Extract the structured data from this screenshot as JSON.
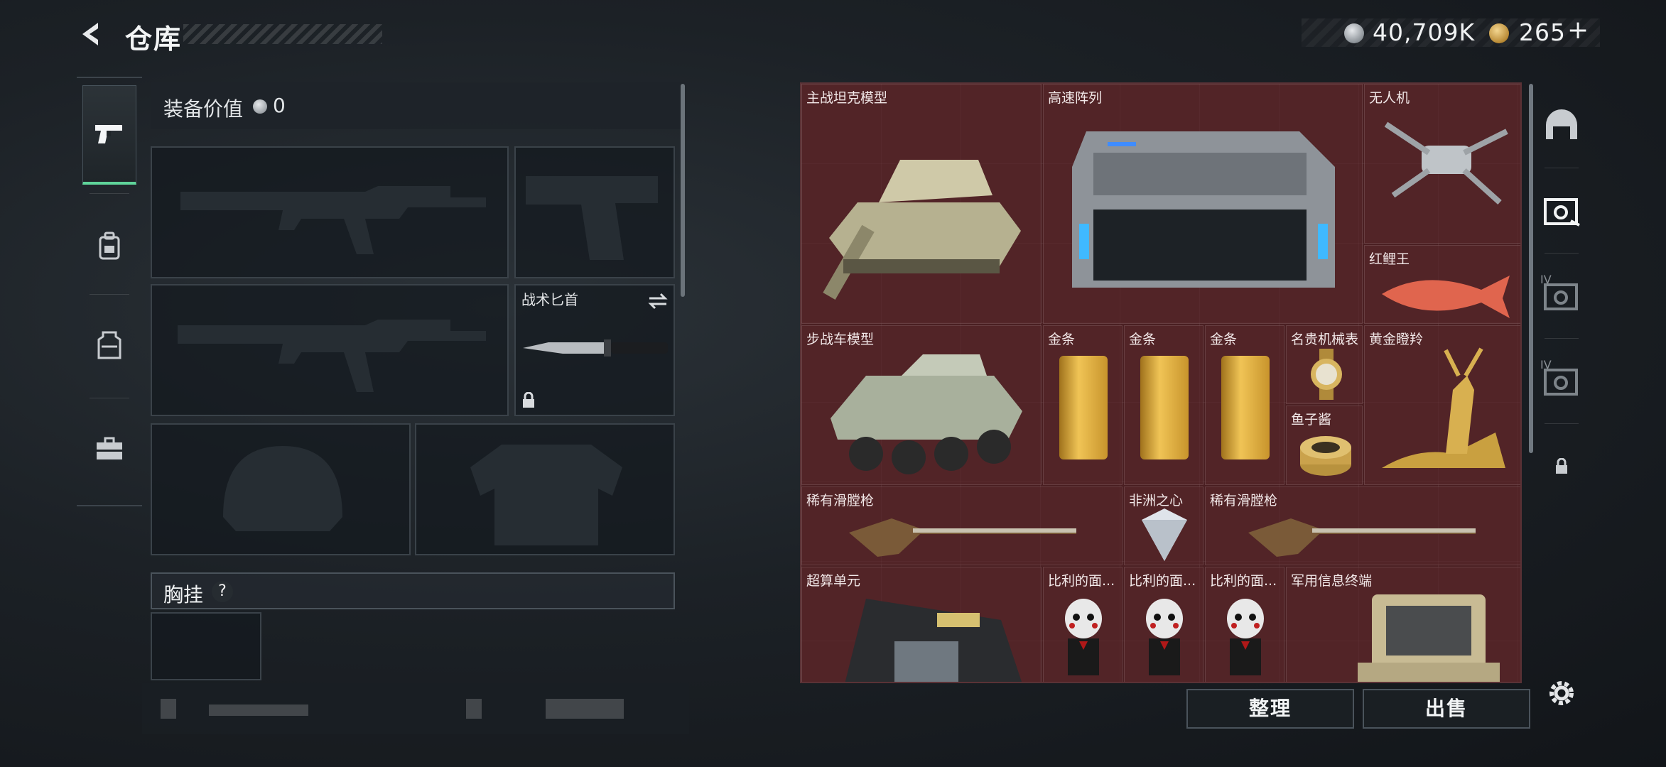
{
  "header": {
    "title": "仓库",
    "currency_silver": "40,709K",
    "currency_gold": "265",
    "add_symbol": "+"
  },
  "sidebar": {
    "tabs": [
      {
        "icon": "pistol-icon",
        "active": true
      },
      {
        "icon": "backpack-icon",
        "active": false
      },
      {
        "icon": "vest-icon",
        "active": false
      },
      {
        "icon": "toolbox-icon",
        "active": false
      }
    ]
  },
  "equipment": {
    "value_label": "装备价值",
    "value": "0",
    "slots": {
      "knife_label": "战术匕首"
    },
    "chest_label": "胸挂",
    "chest_help": "?"
  },
  "storage": {
    "items": [
      {
        "name": "主战坦克模型"
      },
      {
        "name": "高速阵列"
      },
      {
        "name": "无人机"
      },
      {
        "name": "红鲤王"
      },
      {
        "name": "步战车模型"
      },
      {
        "name": "金条"
      },
      {
        "name": "金条"
      },
      {
        "name": "金条"
      },
      {
        "name": "名贵机械表"
      },
      {
        "name": "鱼子酱"
      },
      {
        "name": "黄金瞪羚"
      },
      {
        "name": "稀有滑膛枪"
      },
      {
        "name": "非洲之心"
      },
      {
        "name": "稀有滑膛枪"
      },
      {
        "name": "超算单元"
      },
      {
        "name": "比利的面..."
      },
      {
        "name": "比利的面..."
      },
      {
        "name": "比利的面..."
      },
      {
        "name": "军用信息终端"
      }
    ]
  },
  "buttons": {
    "sort": "整理",
    "sell": "出售"
  },
  "right_tabs": [
    {
      "icon": "helmet-icon",
      "label": ""
    },
    {
      "icon": "case-icon",
      "label": ""
    },
    {
      "icon": "case-icon",
      "label": "IV"
    },
    {
      "icon": "case-icon",
      "label": "IV"
    },
    {
      "icon": "lock-icon",
      "label": ""
    }
  ],
  "colors": {
    "storage_bg": "#4a1f22",
    "active_tab_accent": "#5fd49a"
  }
}
